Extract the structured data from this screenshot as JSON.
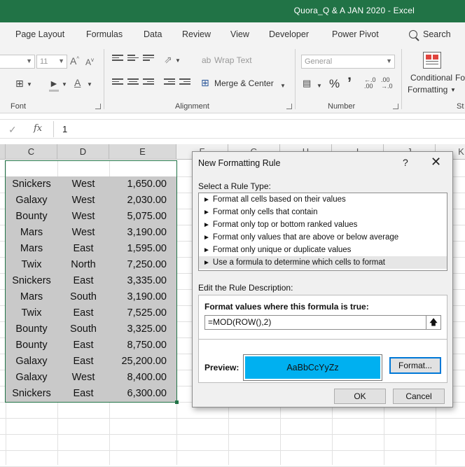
{
  "window": {
    "title": "Quora_Q & A JAN 2020  -  Excel"
  },
  "tabs": [
    "Page Layout",
    "Formulas",
    "Data",
    "Review",
    "View",
    "Developer",
    "Power Pivot"
  ],
  "search": {
    "label": "Search"
  },
  "ribbon": {
    "font": {
      "group_label": "Font",
      "size_value": "11",
      "grow_label": "A",
      "shrink_label": "A"
    },
    "alignment": {
      "group_label": "Alignment",
      "wrap_text": "Wrap Text",
      "merge_center": "Merge & Center"
    },
    "number": {
      "group_label": "Number",
      "format_value": "General",
      "percent": "%",
      "comma": "’"
    },
    "styles": {
      "conditional_formatting_line1": "Conditional",
      "conditional_formatting_line2": "Formatting",
      "cut_label": "Fo",
      "cut_group_label": "St"
    }
  },
  "formula_bar": {
    "fx": "fx",
    "value": "1"
  },
  "columns": [
    "C",
    "D",
    "E",
    "F",
    "G",
    "H",
    "I",
    "J",
    "K"
  ],
  "table": {
    "rows": [
      {
        "product": "Snickers",
        "region": "West",
        "amount": "1,650.00"
      },
      {
        "product": "Galaxy",
        "region": "West",
        "amount": "2,030.00"
      },
      {
        "product": "Bounty",
        "region": "West",
        "amount": "5,075.00"
      },
      {
        "product": "Mars",
        "region": "West",
        "amount": "3,190.00"
      },
      {
        "product": "Mars",
        "region": "East",
        "amount": "1,595.00"
      },
      {
        "product": "Twix",
        "region": "North",
        "amount": "7,250.00"
      },
      {
        "product": "Snickers",
        "region": "East",
        "amount": "3,335.00"
      },
      {
        "product": "Mars",
        "region": "South",
        "amount": "3,190.00"
      },
      {
        "product": "Twix",
        "region": "East",
        "amount": "7,525.00"
      },
      {
        "product": "Bounty",
        "region": "South",
        "amount": "3,325.00"
      },
      {
        "product": "Bounty",
        "region": "East",
        "amount": "8,750.00"
      },
      {
        "product": "Galaxy",
        "region": "East",
        "amount": "25,200.00"
      },
      {
        "product": "Galaxy",
        "region": "West",
        "amount": "8,400.00"
      },
      {
        "product": "Snickers",
        "region": "East",
        "amount": "6,300.00"
      }
    ]
  },
  "dialog": {
    "title": "New Formatting Rule",
    "help": "?",
    "close": "✕",
    "select_rule_type_label": "Select a Rule Type:",
    "rule_types": [
      "Format all cells based on their values",
      "Format only cells that contain",
      "Format only top or bottom ranked values",
      "Format only values that are above or below average",
      "Format only unique or duplicate values",
      "Use a formula to determine which cells to format"
    ],
    "selected_rule_index": 5,
    "edit_description_label": "Edit the Rule Description:",
    "formula_label": "Format values where this formula is true:",
    "formula_value": "=MOD(ROW(),2)",
    "preview_label": "Preview:",
    "preview_text": "AaBbCcYyZz",
    "format_button": "Format...",
    "ok_button": "OK",
    "cancel_button": "Cancel"
  },
  "colors": {
    "excel_green": "#217346",
    "preview_fill": "#00b0f0",
    "shaded_row": "#c9c9c9",
    "focus_blue": "#0078d7"
  }
}
